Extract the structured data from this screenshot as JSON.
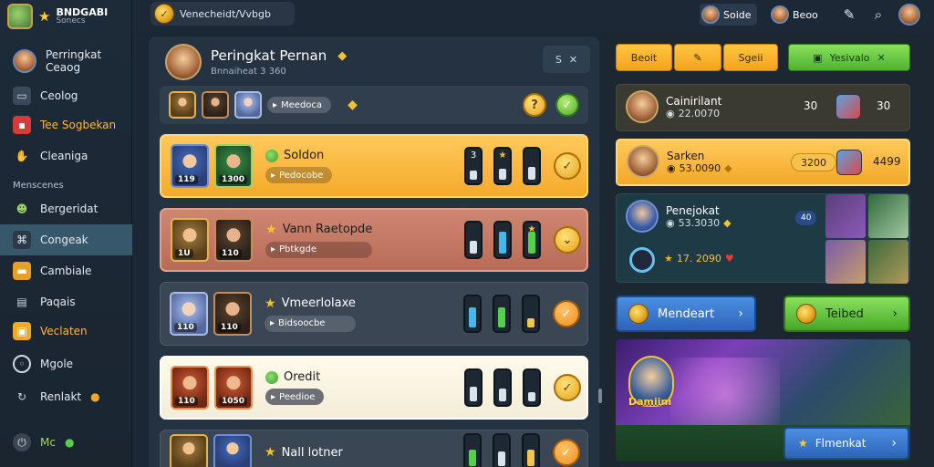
{
  "app": {
    "brand_title": "BNDGABI",
    "brand_sub": "Sonecs"
  },
  "sidebar": {
    "profile_line1": "Perringkat",
    "profile_line2": "Ceaog",
    "heading": "Menscenes",
    "items": [
      {
        "label": "Ceolog",
        "icon": "tv-icon"
      },
      {
        "label": "Tee Sogbekan",
        "icon": "red-box-icon"
      },
      {
        "label": "Cleaniga",
        "icon": "hand-icon"
      },
      {
        "label": "Bergeridat",
        "icon": "person-icon"
      },
      {
        "label": "Congeak",
        "icon": "controller-icon"
      },
      {
        "label": "Cambiale",
        "icon": "pill-icon"
      },
      {
        "label": "Paqais",
        "icon": "card-icon"
      },
      {
        "label": "Veclaten",
        "icon": "gift-icon"
      },
      {
        "label": "Mgole",
        "icon": "circle-icon"
      },
      {
        "label": "Renlakt",
        "icon": "refresh-icon"
      },
      {
        "label": "Mc",
        "icon": "power-icon"
      }
    ]
  },
  "topbar": {
    "search_text": "Venecheidt/Vvbgb",
    "user1": "Soide",
    "user2": "Beoo"
  },
  "board": {
    "title": "Peringkat Pernan",
    "subtitle": "Bnnaiheat 3 360",
    "header_btn": "S",
    "rows": [
      {
        "name": "",
        "pill": "Meedoca",
        "bars": [],
        "button": "gold"
      },
      {
        "name": "Soldon",
        "pill": "Pedocobe",
        "portrait1_num": "119",
        "portrait2_num": "1300",
        "bars": [
          "3",
          "",
          ""
        ],
        "button": "gold"
      },
      {
        "name": "Vann Raetopde",
        "pill": "Pbtkgde",
        "portrait1_num": "1U",
        "portrait2_num": "110",
        "bars": [
          "",
          "",
          ""
        ],
        "button": "gold"
      },
      {
        "name": "Vmeerlolaxe",
        "pill": "Bidsoocbe",
        "portrait1_num": "110",
        "portrait2_num": "110",
        "bars": [
          "",
          "",
          ""
        ],
        "button": "orange"
      },
      {
        "name": "Oredit",
        "pill": "Peedioe",
        "portrait1_num": "110",
        "portrait2_num": "1050",
        "bars": [
          "",
          "",
          ""
        ],
        "button": "gold"
      },
      {
        "name": "Nall lotner",
        "pill": "",
        "bars": [
          "",
          "",
          ""
        ],
        "button": "orange"
      }
    ]
  },
  "right": {
    "tabs": [
      "Beoit",
      "",
      "Sgeii",
      "Yesivalo"
    ],
    "cards": [
      {
        "title": "Cainirilant",
        "amount": "22.0070",
        "v1": "30",
        "v2": "30"
      },
      {
        "title": "Sarken",
        "amount": "53.0090",
        "pill": "3200",
        "v2": "4499"
      },
      {
        "title": "Penejokat",
        "amount": "53.3030",
        "tag": "40",
        "amount2": "17. 2090"
      }
    ],
    "btn_blue": "Mendeart",
    "btn_green": "Teibed",
    "banner_logo": "Damiini",
    "banner_btn": "Flmenkat"
  }
}
